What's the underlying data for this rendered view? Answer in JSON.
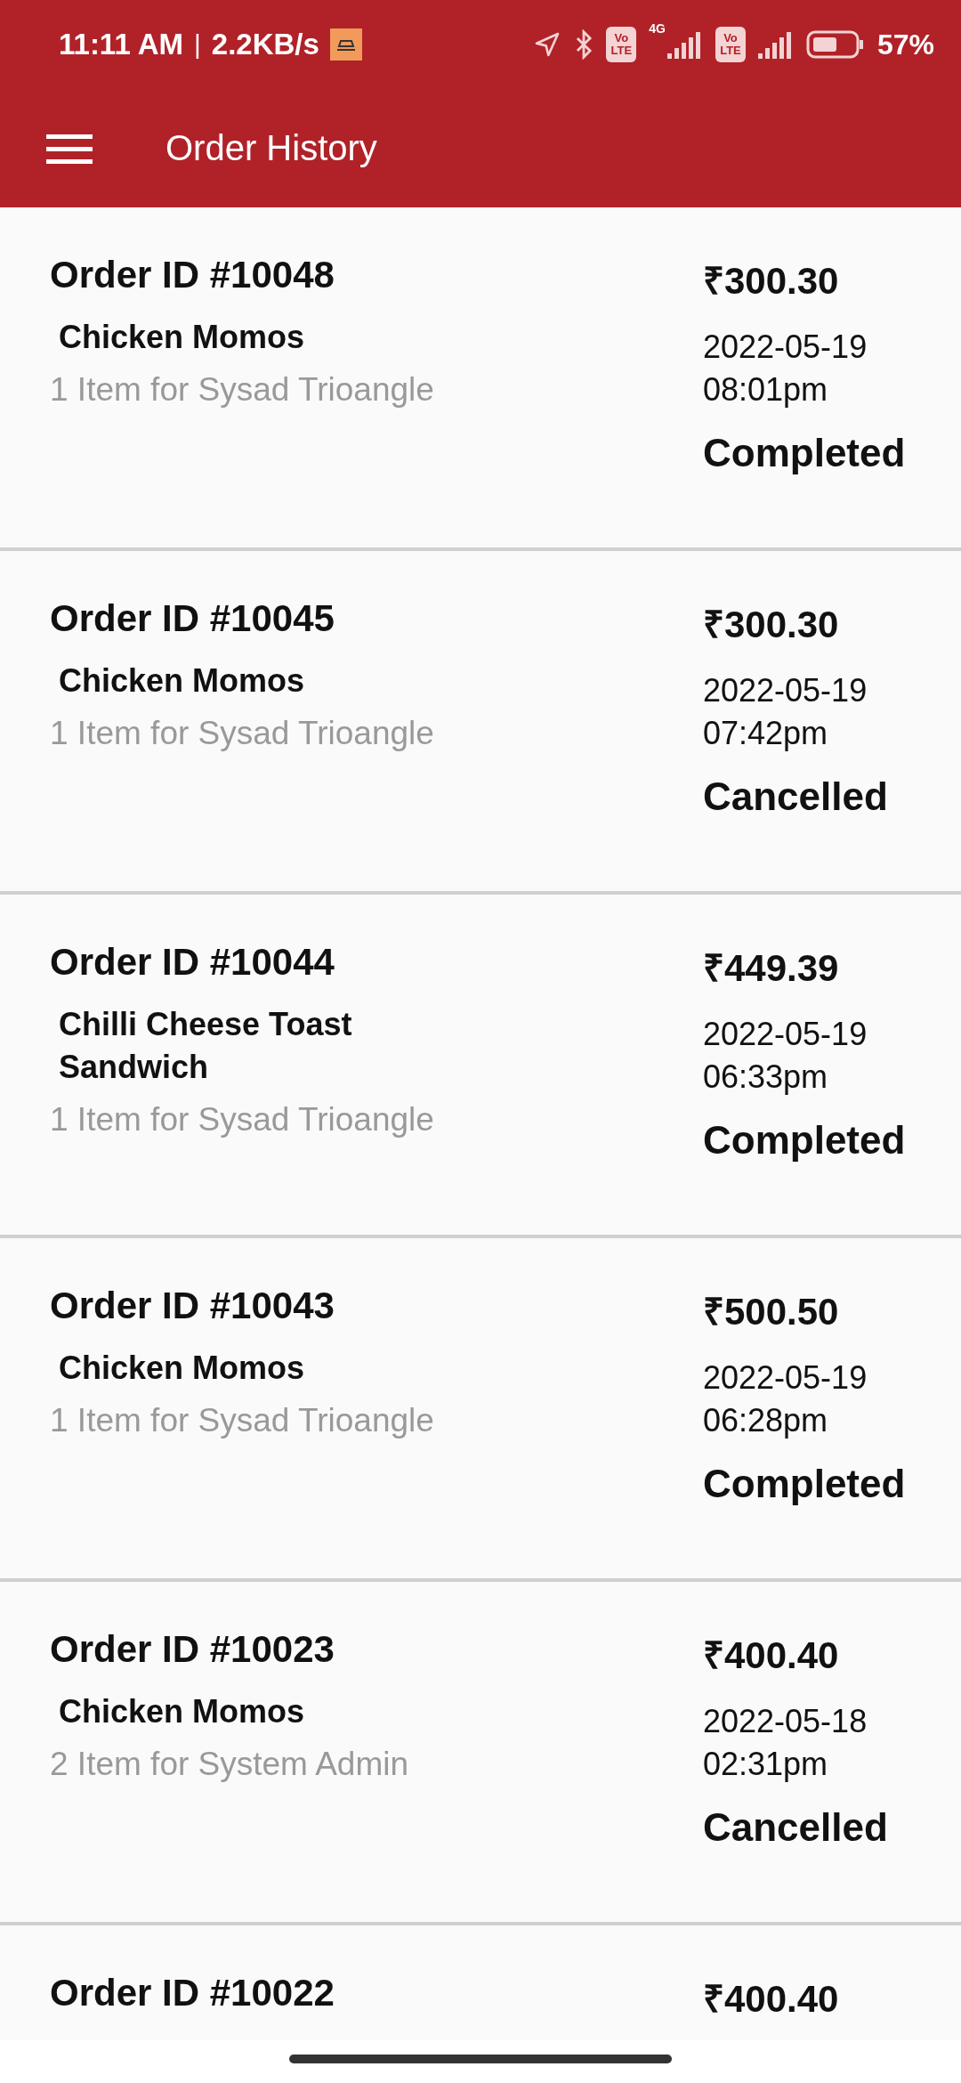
{
  "status_bar": {
    "time": "11:11 AM",
    "separator": "|",
    "speed": "2.2KB/s",
    "sims": [
      {
        "badge_top": "Vo",
        "badge_bottom": "LTE",
        "network": "4G"
      },
      {
        "badge_top": "Vo",
        "badge_bottom": "LTE"
      }
    ],
    "battery_percent": "57%"
  },
  "app_bar": {
    "title": "Order History"
  },
  "orders": [
    {
      "order_id": "Order ID #10048",
      "item": "Chicken Momos",
      "summary": "1 Item for Sysad Trioangle",
      "price": "₹300.30",
      "date": "2022-05-19",
      "time": "08:01pm",
      "status": "Completed"
    },
    {
      "order_id": "Order ID #10045",
      "item": "Chicken Momos",
      "summary": "1 Item for Sysad Trioangle",
      "price": "₹300.30",
      "date": "2022-05-19",
      "time": "07:42pm",
      "status": "Cancelled"
    },
    {
      "order_id": "Order ID #10044",
      "item": "Chilli Cheese Toast Sandwich",
      "summary": "1 Item for Sysad Trioangle",
      "price": "₹449.39",
      "date": "2022-05-19",
      "time": "06:33pm",
      "status": "Completed"
    },
    {
      "order_id": "Order ID #10043",
      "item": "Chicken Momos",
      "summary": "1 Item for Sysad Trioangle",
      "price": "₹500.50",
      "date": "2022-05-19",
      "time": "06:28pm",
      "status": "Completed"
    },
    {
      "order_id": "Order ID #10023",
      "item": "Chicken Momos",
      "summary": "2 Item for System Admin",
      "price": "₹400.40",
      "date": "2022-05-18",
      "time": "02:31pm",
      "status": "Cancelled"
    },
    {
      "order_id": "Order ID #10022",
      "price": "₹400.40"
    }
  ]
}
